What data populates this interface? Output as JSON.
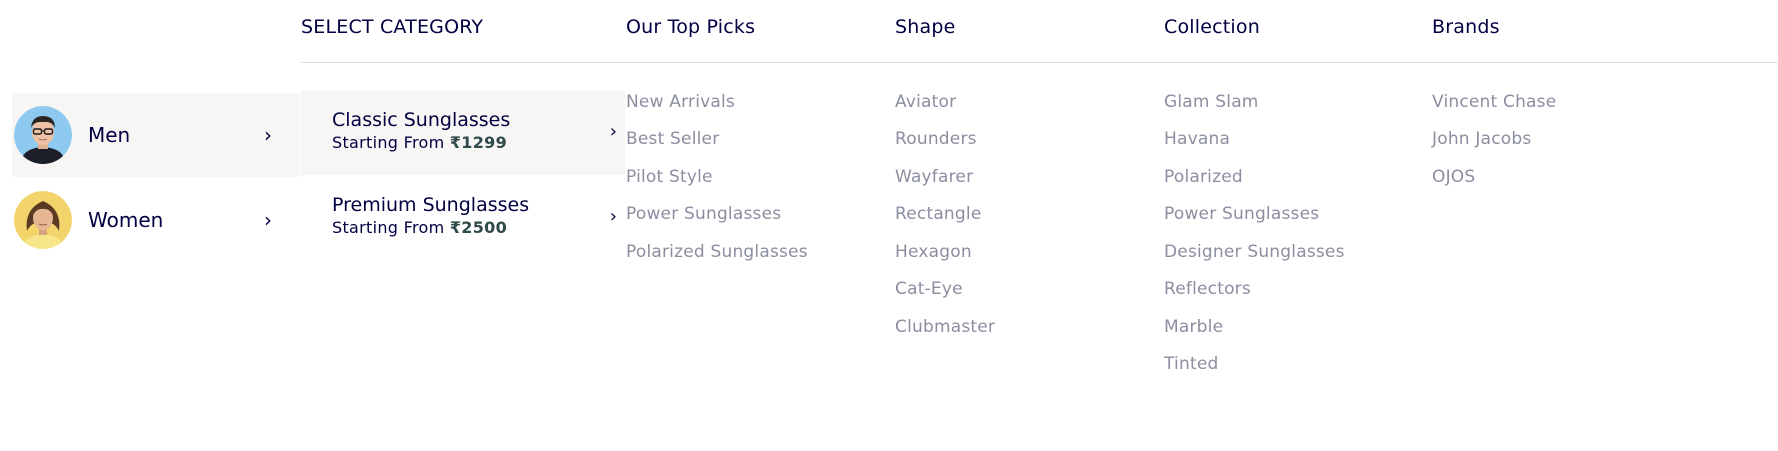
{
  "headers": {
    "select_category": "SELECT CATEGORY",
    "top_picks": "Our Top Picks",
    "shape": "Shape",
    "collection": "Collection",
    "brands": "Brands"
  },
  "genders": [
    {
      "label": "Men",
      "chevron": "›",
      "avatar_icon": "man-avatar",
      "active": true
    },
    {
      "label": "Women",
      "chevron": "›",
      "avatar_icon": "woman-avatar",
      "active": false
    }
  ],
  "categories": [
    {
      "name": "Classic Sunglasses",
      "sub_prefix": "Starting From ",
      "price": "₹1299",
      "chevron": "›",
      "active": true
    },
    {
      "name": "Premium Sunglasses",
      "sub_prefix": "Starting From ",
      "price": "₹2500",
      "chevron": "›",
      "active": false
    }
  ],
  "top_picks": [
    "New Arrivals",
    "Best Seller",
    "Pilot Style",
    "Power Sunglasses",
    "Polarized Sunglasses"
  ],
  "shapes": [
    "Aviator",
    "Rounders",
    "Wayfarer",
    "Rectangle",
    "Hexagon",
    "Cat-Eye",
    "Clubmaster"
  ],
  "collections": [
    "Glam Slam",
    "Havana",
    "Polarized",
    "Power Sunglasses",
    "Designer Sunglasses",
    "Reflectors",
    "Marble",
    "Tinted"
  ],
  "brands": [
    "Vincent Chase",
    "John Jacobs",
    "OJOS"
  ],
  "colors": {
    "primary_text": "#000042",
    "muted_link": "#8b8ea0",
    "active_bg": "#f7f6f4",
    "price_text": "#2f4a4a",
    "divider": "#dcdcdc"
  }
}
